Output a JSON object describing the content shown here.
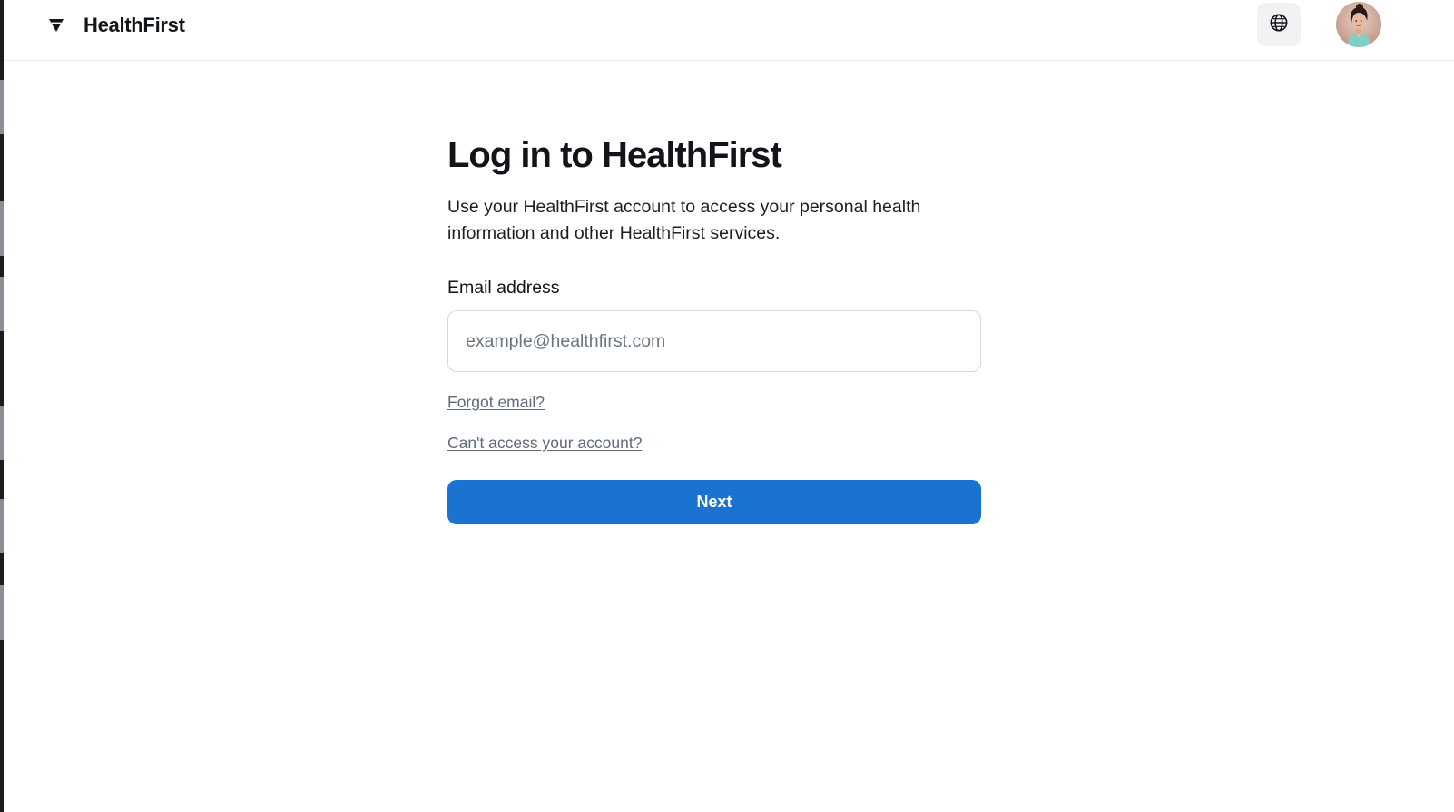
{
  "header": {
    "brand_name": "HealthFirst",
    "logo_icon": "down-triangle-logo-icon",
    "language_icon": "globe-icon",
    "avatar_icon": "user-avatar"
  },
  "login": {
    "title": "Log in to HealthFirst",
    "subtitle": "Use your HealthFirst account to access your personal health information and other HealthFirst services.",
    "email_label": "Email address",
    "email_value": "",
    "email_placeholder": "example@healthfirst.com",
    "forgot_email_link": "Forgot email?",
    "cant_access_link": "Can't access your account?",
    "next_button": "Next"
  },
  "colors": {
    "primary_button": "#1a73d1",
    "link_text": "#5f6b78",
    "title_text": "#111418",
    "input_border": "#d6d9de",
    "icon_button_bg": "#f1f2f4"
  }
}
